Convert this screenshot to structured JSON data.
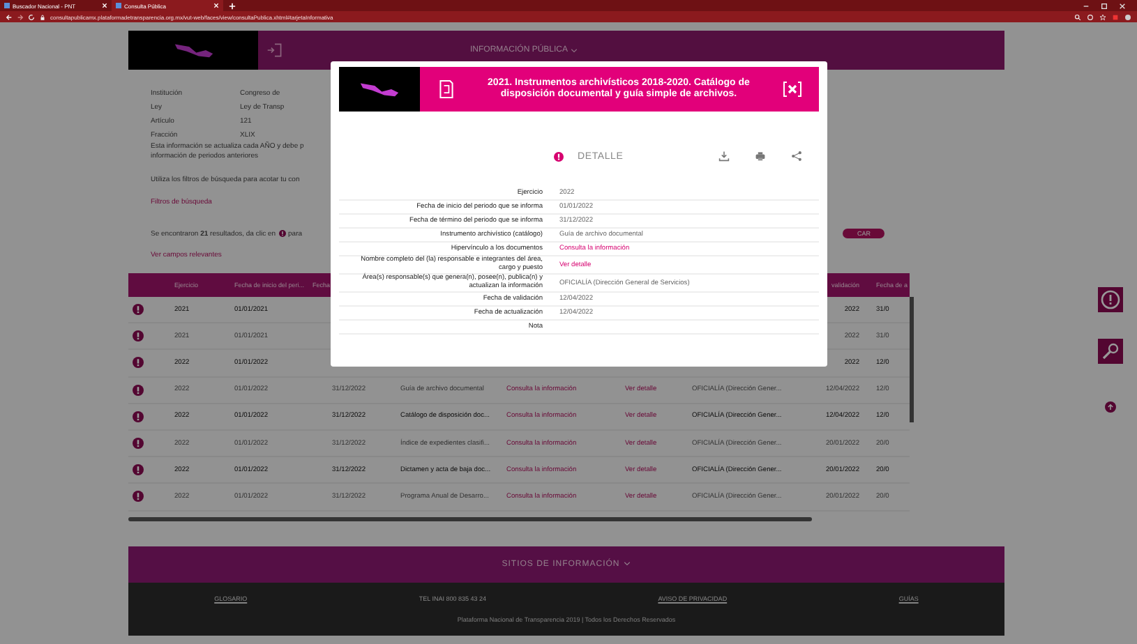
{
  "browser": {
    "tabs": [
      {
        "title": "Buscador Nacional - PNT",
        "selected": false
      },
      {
        "title": "Consulta Pública",
        "selected": true
      }
    ],
    "url": "consultapublicamx.plataformadetransparencia.org.mx/vut-web/faces/view/consultaPublica.xhtml#tarjetaInformativa"
  },
  "header": {
    "menu": "INFORMACIÓN PÚBLICA"
  },
  "info": {
    "fields": [
      {
        "label": "Institución",
        "value": "Congreso de"
      },
      {
        "label": "Ley",
        "value": "Ley de Transp"
      },
      {
        "label": "Artículo",
        "value": "121"
      },
      {
        "label": "Fracción",
        "value": "XLIX"
      }
    ],
    "notes": [
      "Esta información se actualiza cada AÑO y debe p",
      "información de periodos anteriores"
    ],
    "filter_hint": "Utiliza los filtros de búsqueda para acotar tu con",
    "filters_link": "Filtros de búsqueda",
    "results": "Se encontraron **21** resultados, da clic en",
    "results_tail": "para",
    "pill": "CAR",
    "relevant_link": "Ver campos relevantes"
  },
  "table": {
    "columns": [
      "Ejercicio",
      "Fecha de inicio del peri...",
      "Fecha",
      "validación",
      "Fecha de a"
    ],
    "rows": [
      {
        "dimmed": false,
        "ejercicio": "2021",
        "inicio": "01/01/2021",
        "validacion": "2022",
        "actualizacion": "31/0"
      },
      {
        "dimmed": true,
        "ejercicio": "2021",
        "inicio": "01/01/2021",
        "validacion": "2022",
        "actualizacion": "31/0"
      },
      {
        "dimmed": false,
        "ejercicio": "2022",
        "inicio": "01/01/2022",
        "validacion": "2022",
        "actualizacion": "12/0"
      },
      {
        "dimmed": true,
        "ejercicio": "2022",
        "inicio": "01/01/2022",
        "termino": "31/12/2022",
        "instrumento": "Guía de archivo documental",
        "hipervinculo": "Consulta la información",
        "detalle": "Ver detalle",
        "area": "OFICIALÍA (Dirección Gener...",
        "validacion": "12/04/2022",
        "actualizacion": "12/0"
      },
      {
        "dimmed": false,
        "ejercicio": "2022",
        "inicio": "01/01/2022",
        "termino": "31/12/2022",
        "instrumento": "Catálogo de disposición doc...",
        "hipervinculo": "Consulta la información",
        "detalle": "Ver detalle",
        "area": "OFICIALÍA (Dirección Gener...",
        "validacion": "12/04/2022",
        "actualizacion": "12/0"
      },
      {
        "dimmed": true,
        "ejercicio": "2022",
        "inicio": "01/01/2022",
        "termino": "31/12/2022",
        "instrumento": "Índice de expedientes clasifi...",
        "hipervinculo": "Consulta la información",
        "detalle": "Ver detalle",
        "area": "OFICIALÍA (Dirección Gener...",
        "validacion": "20/01/2022",
        "actualizacion": "20/0"
      },
      {
        "dimmed": false,
        "ejercicio": "2022",
        "inicio": "01/01/2022",
        "termino": "31/12/2022",
        "instrumento": "Dictamen y acta de baja doc...",
        "hipervinculo": "Consulta la información",
        "detalle": "Ver detalle",
        "area": "OFICIALÍA (Dirección Gener...",
        "validacion": "20/01/2022",
        "actualizacion": "20/0"
      },
      {
        "dimmed": true,
        "ejercicio": "2022",
        "inicio": "01/01/2022",
        "termino": "31/12/2022",
        "instrumento": "Programa Anual de Desarro...",
        "hipervinculo": "Consulta la información",
        "detalle": "Ver detalle",
        "area": "OFICIALÍA (Dirección Gener...",
        "validacion": "20/01/2022",
        "actualizacion": "20/0"
      }
    ]
  },
  "footer": {
    "band": "SITIOS DE INFORMACIÓN",
    "links": [
      {
        "label": "GLOSARIO",
        "kind": "link"
      },
      {
        "label": "TEL INAI 800 835 43 24",
        "kind": "text"
      },
      {
        "label": "AVISO DE PRIVACIDAD",
        "kind": "link"
      },
      {
        "label": "GUÍAS",
        "kind": "link"
      }
    ],
    "copyright": "Plataforma Nacional de Transparencia 2019 | Todos los Derechos Reservados"
  },
  "modal": {
    "title": "2021. Instrumentos archivísticos 2018-2020. Catálogo de disposición documental y guía simple de archivos.",
    "detail_label": "DETALLE",
    "fields": [
      {
        "label": "Ejercicio",
        "value": "2022",
        "kind": "text"
      },
      {
        "label": "Fecha de inicio del periodo que se informa",
        "value": "01/01/2022",
        "kind": "text"
      },
      {
        "label": "Fecha de término del periodo que se informa",
        "value": "31/12/2022",
        "kind": "text"
      },
      {
        "label": "Instrumento archivístico (catálogo)",
        "value": "Guía de archivo documental",
        "kind": "text"
      },
      {
        "label": "Hipervínculo a los documentos",
        "value": "Consulta la información",
        "kind": "link"
      },
      {
        "label": "Nombre completo del (la) responsable e integrantes del área, cargo y puesto",
        "value": "Ver detalle",
        "kind": "link"
      },
      {
        "label": "Área(s) responsable(s) que genera(n), posee(n), publica(n) y actualizan la información",
        "value": "OFICIALÍA (Dirección General de Servicios)",
        "kind": "text"
      },
      {
        "label": "Fecha de validación",
        "value": "12/04/2022",
        "kind": "text"
      },
      {
        "label": "Fecha de actualización",
        "value": "12/04/2022",
        "kind": "text"
      },
      {
        "label": "Nota"
      }
    ]
  }
}
